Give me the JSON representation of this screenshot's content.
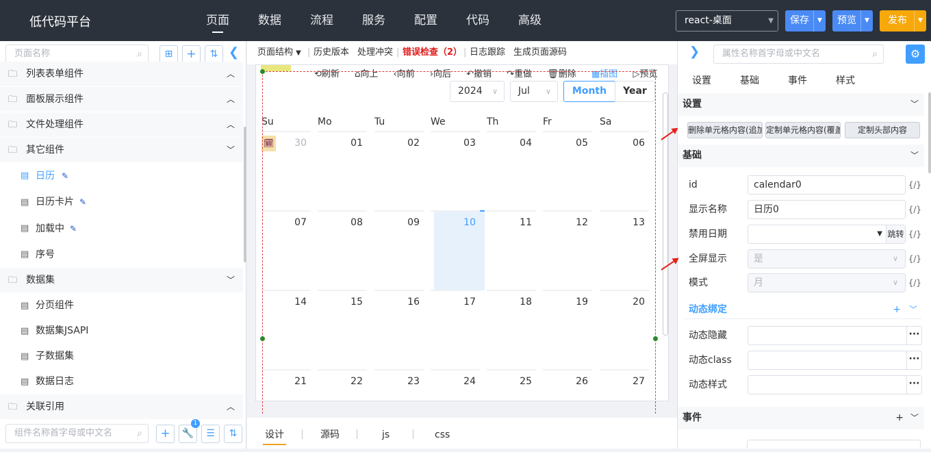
{
  "app": {
    "title": "低代码平台",
    "nav": [
      "页面",
      "数据",
      "流程",
      "服务",
      "配置",
      "代码",
      "高级"
    ],
    "project_select": "react-桌面",
    "buttons": {
      "save": "保存",
      "preview": "预览",
      "publish": "发布"
    },
    "colors": {
      "header_bg": "#2b323c",
      "save": "#4a8af4",
      "preview": "#4a8af4",
      "publish": "#f7a80a",
      "accent": "#409eff"
    }
  },
  "left": {
    "page_search_placeholder": "页面名称",
    "component_search_placeholder": "组件名称首字母或中文名",
    "badge_count": "1",
    "tree": [
      {
        "label": "列表表单组件",
        "type": "group",
        "arrow": "up"
      },
      {
        "label": "面板展示组件",
        "type": "group",
        "arrow": "up"
      },
      {
        "label": "文件处理组件",
        "type": "group",
        "arrow": "up"
      },
      {
        "label": "其它组件",
        "type": "group",
        "arrow": "down"
      },
      {
        "label": "日历",
        "type": "leaf",
        "selected": true,
        "edit": true
      },
      {
        "label": "日历卡片",
        "type": "leaf",
        "edit": true
      },
      {
        "label": "加载中",
        "type": "leaf",
        "edit": true
      },
      {
        "label": "序号",
        "type": "leaf"
      },
      {
        "label": "数据集",
        "type": "group",
        "arrow": "down"
      },
      {
        "label": "分页组件",
        "type": "leaf"
      },
      {
        "label": "数据集JSAPI",
        "type": "leaf"
      },
      {
        "label": "子数据集",
        "type": "leaf"
      },
      {
        "label": "数据日志",
        "type": "leaf"
      },
      {
        "label": "关联引用",
        "type": "group",
        "arrow": "up"
      }
    ]
  },
  "toolbar": {
    "structure": "页面结构",
    "history": "历史版本",
    "conflict": "处理冲突",
    "errors": "错误检查（2）",
    "log": "日志跟踪",
    "source": "生成页面源码"
  },
  "canvas_actions": [
    "刷新",
    "向上",
    "向前",
    "向后",
    "撤销",
    "重做",
    "删除",
    "插图",
    "预览"
  ],
  "calendar": {
    "year": "2024",
    "month": "Jul",
    "mode_month": "Month",
    "mode_year": "Year",
    "weekdays": [
      "Su",
      "Mo",
      "Tu",
      "We",
      "Th",
      "Fr",
      "Sa"
    ],
    "weeks": [
      [
        "30",
        "01",
        "02",
        "03",
        "04",
        "05",
        "06"
      ],
      [
        "07",
        "08",
        "09",
        "10",
        "11",
        "12",
        "13"
      ],
      [
        "14",
        "15",
        "16",
        "17",
        "18",
        "19",
        "20"
      ],
      [
        "21",
        "22",
        "23",
        "24",
        "25",
        "26",
        "27"
      ]
    ],
    "today": "10",
    "event_glyph": "🗓"
  },
  "bottom_tabs": [
    "设计",
    "源码",
    "js",
    "css"
  ],
  "right": {
    "search_placeholder": "属性名称首字母或中文名",
    "tabs": [
      "设置",
      "基础",
      "事件",
      "样式"
    ],
    "sections": {
      "settings": "设置",
      "basic": "基础",
      "events": "事件"
    },
    "setting_buttons": [
      "删除单元格内容(追加)",
      "定制单元格内容(覆盖)",
      "定制头部内容"
    ],
    "props": [
      {
        "label": "id",
        "value": "calendar0",
        "kind": "text"
      },
      {
        "label": "显示名称",
        "value": "日历0",
        "kind": "text"
      },
      {
        "label": "禁用日期",
        "value": "",
        "kind": "jump",
        "jump": "跳转"
      },
      {
        "label": "全屏显示",
        "value": "是",
        "kind": "select-dis"
      },
      {
        "label": "模式",
        "value": "月",
        "kind": "select-dis"
      }
    ],
    "dynamic_title": "动态绑定",
    "dynamic": [
      {
        "label": "动态隐藏"
      },
      {
        "label": "动态class"
      },
      {
        "label": "动态样式"
      }
    ],
    "fx": "{/}"
  }
}
